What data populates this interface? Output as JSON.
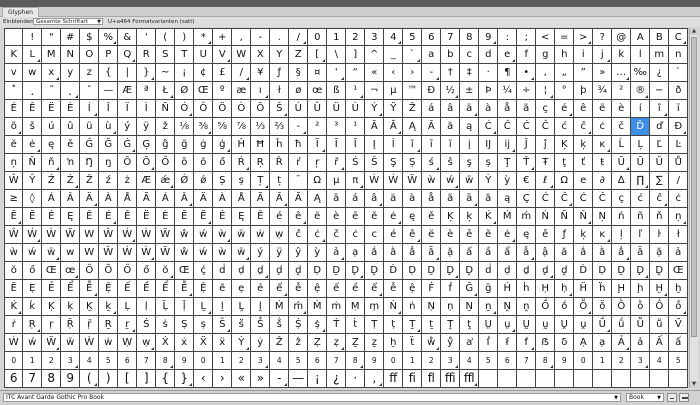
{
  "panel": {
    "tab": "Glyphen"
  },
  "options": {
    "show_label": "Einblenden:",
    "show_value": "Gesamte Schriftart",
    "glyph_info": "U+a464 Formatvarianten (satt)"
  },
  "font": {
    "family": "ITC Avant Garde Gothic Pro Book",
    "style": "Book"
  },
  "colors": {
    "selection": "#3d8ee6"
  },
  "icons": {
    "zoom_out": "zoom-out-icon",
    "zoom_in": "zoom-in-icon",
    "dropdown": "chevron-down-icon"
  },
  "selected_glyph": "Ď",
  "glyph_rows": [
    [
      "",
      "!",
      "\"",
      "#",
      "$",
      "%",
      "&",
      "'",
      "(",
      ")",
      "*",
      "+",
      ",",
      "-",
      ".",
      "/",
      "0",
      "1",
      "2",
      "3",
      "4",
      "5",
      "6",
      "7",
      "8",
      "9",
      ":",
      ";",
      "<",
      "=",
      ">",
      "?",
      "@",
      "A",
      "B",
      "C",
      "D",
      "E",
      "F",
      "G",
      "H",
      "I",
      "J"
    ],
    [
      "K",
      "L",
      "M",
      "N",
      "O",
      "P",
      "Q",
      "R",
      "S",
      "T",
      "U",
      "V",
      "W",
      "X",
      "Y",
      "Z",
      "[",
      "\\",
      "]",
      "^",
      "_",
      "`",
      "a",
      "b",
      "c",
      "d",
      "e",
      "f",
      "g",
      "h",
      "i",
      "j",
      "k",
      "l",
      "m",
      "n",
      "o",
      "p",
      "q",
      "r",
      "s",
      "t",
      "u"
    ],
    [
      "v",
      "w",
      "x",
      "y",
      "z",
      "{",
      "|",
      "}",
      "~",
      "¡",
      "¢",
      "£",
      "/",
      "¥",
      "ƒ",
      "§",
      "¤",
      "'",
      "“",
      "«",
      "‹",
      "›",
      "-",
      "†",
      "‡",
      "·",
      "¶",
      "•",
      "‚",
      "„",
      "”",
      "»",
      "…",
      "‰",
      "¿",
      "`",
      "´",
      "ˆ",
      "˜",
      "¯",
      "˘",
      "˙",
      "¨"
    ],
    [
      "˚",
      "¸",
      "˝",
      "˛",
      "ˇ",
      "—",
      "Æ",
      "ª",
      "Ł",
      "Ø",
      "Œ",
      "º",
      "æ",
      "ı",
      "ł",
      "ø",
      "œ",
      "ß",
      "¹",
      "¬",
      "µ",
      "™",
      "Đ",
      "½",
      "±",
      "Þ",
      "¼",
      "÷",
      "¦",
      "°",
      "þ",
      "¾",
      "²",
      "®",
      "−",
      "ð",
      "×",
      "³",
      "©",
      "Á",
      "Â",
      "Ä",
      "À",
      "Å",
      "Ã",
      "Ç"
    ],
    [
      "É",
      "Ê",
      "Ë",
      "È",
      "Í",
      "Î",
      "Ï",
      "Ì",
      "Ñ",
      "Ó",
      "Ô",
      "Ö",
      "Ò",
      "Õ",
      "Š",
      "Ú",
      "Û",
      "Ü",
      "Ù",
      "Ý",
      "Ÿ",
      "Ž",
      "á",
      "â",
      "ä",
      "à",
      "å",
      "ã",
      "ç",
      "é",
      "ê",
      "ë",
      "è",
      "í",
      "î",
      "ï",
      "ì",
      "ñ",
      "ó",
      "ô",
      "ö",
      "ò"
    ],
    [
      "õ",
      "š",
      "ú",
      "û",
      "ü",
      "ù",
      "ý",
      "ÿ",
      "ž",
      "⅛",
      "⅜",
      "⅝",
      "⅞",
      "⅓",
      "⅔",
      "-",
      "²",
      "³",
      "¹",
      "Ā",
      "Ă",
      "Ą",
      "Ā",
      "ă",
      "ą",
      "Ć",
      "Ĉ",
      "Ċ",
      "Č",
      "ć",
      "ĉ",
      "ċ",
      "č",
      "Ď",
      "ď",
      "Đ",
      "đ",
      "Ē",
      "Ĕ",
      "Ė",
      "Ę",
      "Ě",
      "ē"
    ],
    [
      "ĕ",
      "ė",
      "ę",
      "ě",
      "Ĝ",
      "Ğ",
      "Ġ",
      "Ģ",
      "ĝ",
      "ğ",
      "ġ",
      "ģ",
      "Ĥ",
      "Ħ",
      "ĥ",
      "ħ",
      "Ĩ",
      "Ī",
      "Ĭ",
      "Į",
      "İ",
      "ĩ",
      "ī",
      "ĭ",
      "į",
      "Ĳ",
      "ĳ",
      "Ĵ",
      "ĵ",
      "Ķ",
      "ķ",
      "ĸ",
      "Ĺ",
      "Ļ",
      "Ľ",
      "Ŀ",
      "ĺ",
      "ļ",
      "ľ",
      "ŀ",
      "Ń",
      "Ņ"
    ],
    [
      "ņ",
      "Ň",
      "ň",
      "ŉ",
      "Ŋ",
      "ŋ",
      "Ō",
      "Ŏ",
      "Ő",
      "ō",
      "ŏ",
      "ő",
      "Ŕ",
      "Ŗ",
      "Ř",
      "ŕ",
      "ŗ",
      "ř",
      "Ś",
      "Ŝ",
      "Ş",
      "Ș",
      "ś",
      "ŝ",
      "ş",
      "ș",
      "Ţ",
      "Ť",
      "Ŧ",
      "ţ",
      "ť",
      "ŧ",
      "Ũ",
      "Ū",
      "Ŭ",
      "Ů",
      "Ű",
      "Ų",
      "ũ",
      "ū",
      "ŭ",
      "ů",
      "ű",
      "ų"
    ],
    [
      "Ŵ",
      "Ŷ",
      "Ź",
      "Ż",
      "Ž",
      "ź",
      "ż",
      "Æ",
      "ǽ",
      "Ǿ",
      "ǿ",
      "Ș",
      "ș",
      "Ț",
      "ț",
      "ˉ",
      "Ω",
      "μ",
      "π",
      "Ẁ",
      "Ẃ",
      "Ẅ",
      "ẁ",
      "ẃ",
      "ẅ",
      "Ỳ",
      "ỳ",
      "€",
      "ℓ",
      "Ω",
      "e",
      "∂",
      "∆",
      "∏",
      "∑",
      "/",
      "·",
      "√",
      "∞",
      "∫",
      "≈",
      "≠",
      "≤"
    ],
    [
      "≥",
      "◊",
      "Á",
      "Â",
      "Ä",
      "À",
      "Å",
      "Ã",
      "Á",
      "Â",
      "Ä",
      "À",
      "Å",
      "Ã",
      "Ā",
      "Ă",
      "Ą",
      "ā",
      "á",
      "â",
      "ä",
      "à",
      "å",
      "ã",
      "ā",
      "ă",
      "ą",
      "Ç",
      "Ć",
      "Ĉ",
      "Ċ",
      "Č",
      "ç",
      "ć",
      "ĉ",
      "ċ",
      "č",
      "Ŵ",
      "Ẃ",
      "Ẁ",
      "Ẅ",
      "W"
    ],
    [
      "Ē",
      "Ĕ",
      "Ė",
      "Ę",
      "Ě",
      "É",
      "Ê",
      "Ë",
      "È",
      "Ē",
      "Ĕ",
      "Ė",
      "Ę",
      "Ě",
      "é",
      "ê",
      "ë",
      "è",
      "ē",
      "ĕ",
      "ė",
      "ę",
      "ě",
      "Ķ",
      "ķ",
      "Ḱ",
      "Ḿ",
      "ḿ",
      "Ń",
      "Ñ",
      "Ň",
      "Ņ",
      "ń",
      "ñ",
      "ň",
      "ņ",
      "Ú",
      "Û",
      "Ü",
      "Ù",
      "Ū",
      "Ŭ"
    ],
    [
      "Ŵ",
      "Ẃ",
      "Ẁ",
      "Ẅ",
      "W",
      "Ŵ",
      "Ẃ",
      "Ẁ",
      "Ẅ",
      "ŵ",
      "ẃ",
      "ẁ",
      "ẅ",
      "ẇ",
      "ẉ",
      "ĉ",
      "ċ",
      "č",
      "ċ",
      "c",
      "é",
      "ê",
      "ë",
      "è",
      "ē",
      "ĕ",
      "ė",
      "ę",
      "ě",
      "ƒ",
      "ķ",
      "ĸ",
      "ļ",
      "ľ",
      "ŀ",
      "ł",
      "ļ",
      "ľ",
      "ŀ",
      "ł",
      "ẁ",
      "ẃ"
    ],
    [
      "ẁ",
      "ẃ",
      "ẅ",
      "w",
      "W",
      "Ŵ",
      "Ẃ",
      "Ẁ",
      "Ẅ",
      "ŵ",
      "ẃ",
      "ẁ",
      "ẅ",
      "ý",
      "ÿ",
      "ŷ",
      "ỳ",
      "ả",
      "ạ",
      "ắ",
      "ằ",
      "ẳ",
      "ẵ",
      "ặ",
      "ấ",
      "ầ",
      "ẩ",
      "ẫ",
      "ậ",
      "ă",
      "ắ",
      "ằ",
      "ẳ",
      "ẵ",
      "ặ",
      "ả",
      "ạ",
      "Œ",
      "œ",
      "Ŏ",
      "Ő"
    ],
    [
      "ŏ",
      "ő",
      "Œ",
      "œ",
      "Ő",
      "Ŏ",
      "Ő",
      "ő",
      "ŏ",
      "Œ",
      "ḉ",
      "ḋ",
      "ḍ",
      "ḏ",
      "ḑ",
      "ḓ",
      "Ḍ",
      "Ḏ",
      "Ḑ",
      "Ḓ",
      "Ḋ",
      "Ḍ",
      "Ḏ",
      "Ḑ",
      "Ḓ",
      "ḋ",
      "ḍ",
      "ḏ",
      "ḑ",
      "ḓ",
      "Ḋ",
      "Ḍ",
      "Ḏ",
      "Ḑ",
      "Ḓ",
      "Œ",
      "œ",
      "Ŏ",
      "Ő"
    ],
    [
      "Ẽ",
      "Ẹ",
      "Ẻ",
      "Ể",
      "Ễ",
      "Ệ",
      "Ế",
      "Ề",
      "Ể",
      "Ễ",
      "Ệ",
      "ẽ",
      "ẹ",
      "ẻ",
      "ể",
      "ễ",
      "ệ",
      "ế",
      "ề",
      "ể",
      "ễ",
      "ệ",
      "Ḟ",
      "ḟ",
      "Ḡ",
      "ḡ",
      "Ḣ",
      "ḣ",
      "Ḥ",
      "ḥ",
      "Ḧ",
      "ḧ",
      "Ḩ",
      "ḩ",
      "Ḫ",
      "ḫ",
      "Ḭ",
      "ḭ",
      "Ḯ",
      "ḯ"
    ],
    [
      "Ḱ",
      "ḱ",
      "Ḳ",
      "ḳ",
      "Ḵ",
      "ḵ",
      "Ḷ",
      "ḷ",
      "Ḹ",
      "ḹ",
      "Ḻ",
      "ḻ",
      "Ḽ",
      "ḽ",
      "Ḿ",
      "ḿ",
      "Ṁ",
      "ṁ",
      "Ṃ",
      "ṃ",
      "Ṅ",
      "ṅ",
      "Ṇ",
      "ṇ",
      "Ṉ",
      "ṉ",
      "Ṋ",
      "ṋ",
      "Ṍ",
      "ṍ",
      "Ṏ",
      "ṏ",
      "Ṑ",
      "ṑ",
      "Ṓ",
      "ṓ",
      "Ṕ",
      "ṕ",
      "Ṗ",
      "ṗ",
      "Ṙ"
    ],
    [
      "ṙ",
      "Ṛ",
      "ṛ",
      "Ṝ",
      "ṝ",
      "Ṟ",
      "ṟ",
      "Ṡ",
      "ṡ",
      "Ṣ",
      "ṣ",
      "Ṥ",
      "ṥ",
      "Ṧ",
      "ṧ",
      "Ṩ",
      "ṩ",
      "Ṫ",
      "ṫ",
      "Ṭ",
      "ṭ",
      "Ṯ",
      "ṯ",
      "Ṱ",
      "ṱ",
      "Ṳ",
      "ṳ",
      "Ṵ",
      "ṵ",
      "Ṷ",
      "ṷ",
      "Ṹ",
      "ṹ",
      "Ṻ",
      "ṻ",
      "Ṽ",
      "ṽ",
      "Ṿ",
      "ṿ",
      "Ẁ",
      "ẁ"
    ],
    [
      "Ẃ",
      "ẃ",
      "Ẅ",
      "ẅ",
      "Ẇ",
      "ẇ",
      "Ẉ",
      "ẉ",
      "Ẋ",
      "ẋ",
      "Ẍ",
      "ẍ",
      "Ẏ",
      "ẏ",
      "Ẑ",
      "ẑ",
      "Ẓ",
      "ẓ",
      "Ẕ",
      "ẕ",
      "ẖ",
      "ẗ",
      "ẘ",
      "ẙ",
      "ẚ",
      "ẛ",
      "ẜ",
      "ẝ",
      "ẞ",
      "ẟ",
      "Ạ",
      "ạ",
      "Ả",
      "ả",
      "Ấ",
      "ấ",
      "Ầ",
      "ầ",
      "Ẩ",
      "ẩ",
      "Ẫ"
    ],
    [
      "0",
      "1",
      "2",
      "3",
      "4",
      "5",
      "6",
      "7",
      "8",
      "9",
      "0",
      "1",
      "2",
      "3",
      "4",
      "5",
      "6",
      "7",
      "8",
      "9",
      "0",
      "1",
      "2",
      "3",
      "4",
      "5",
      "6",
      "7",
      "8",
      "9",
      "0",
      "1",
      "2",
      "3",
      "4",
      "5",
      "6",
      "7",
      "8",
      "9",
      "0",
      "1",
      "2",
      "3",
      "4",
      "5"
    ],
    [
      "6",
      "7",
      "8",
      "9",
      "(",
      ")",
      "[",
      "]",
      "{",
      "}",
      "‹",
      "›",
      "«",
      "»",
      "-",
      "—",
      "¡",
      "¿",
      "·",
      "‚",
      "ff",
      "fi",
      "fl",
      "ffi",
      "ffl",
      "",
      "",
      "",
      "",
      "",
      "",
      "",
      "",
      "",
      "",
      ""
    ]
  ]
}
